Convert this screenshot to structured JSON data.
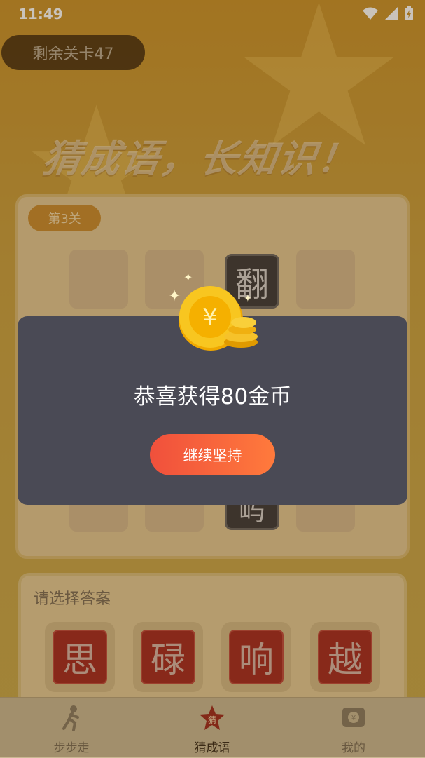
{
  "status_bar": {
    "time": "11:49"
  },
  "header": {
    "levels_remaining": "剩余关卡47",
    "slogan": "猜成语，长知识！"
  },
  "puzzle": {
    "level_badge": "第3关",
    "row1": [
      "",
      "",
      "翻",
      ""
    ],
    "row2_partial": [
      "",
      "",
      "",
      ""
    ]
  },
  "answers": {
    "title": "请选择答案",
    "options": [
      "思",
      "碌",
      "响",
      "越"
    ]
  },
  "tabbar": {
    "items": [
      {
        "label": "步步走",
        "icon": "walk-icon"
      },
      {
        "label": "猜成语",
        "icon": "star-badge-icon"
      },
      {
        "label": "我的",
        "icon": "wallet-icon"
      }
    ]
  },
  "modal": {
    "coin_symbol": "¥",
    "message": "恭喜获得80金币",
    "button_label": "继续坚持"
  },
  "colors": {
    "modal_bg": "#4a4a55",
    "button_gradient_start": "#f0503c",
    "button_gradient_end": "#ff7a3c",
    "coin_gold": "#f5b800"
  }
}
